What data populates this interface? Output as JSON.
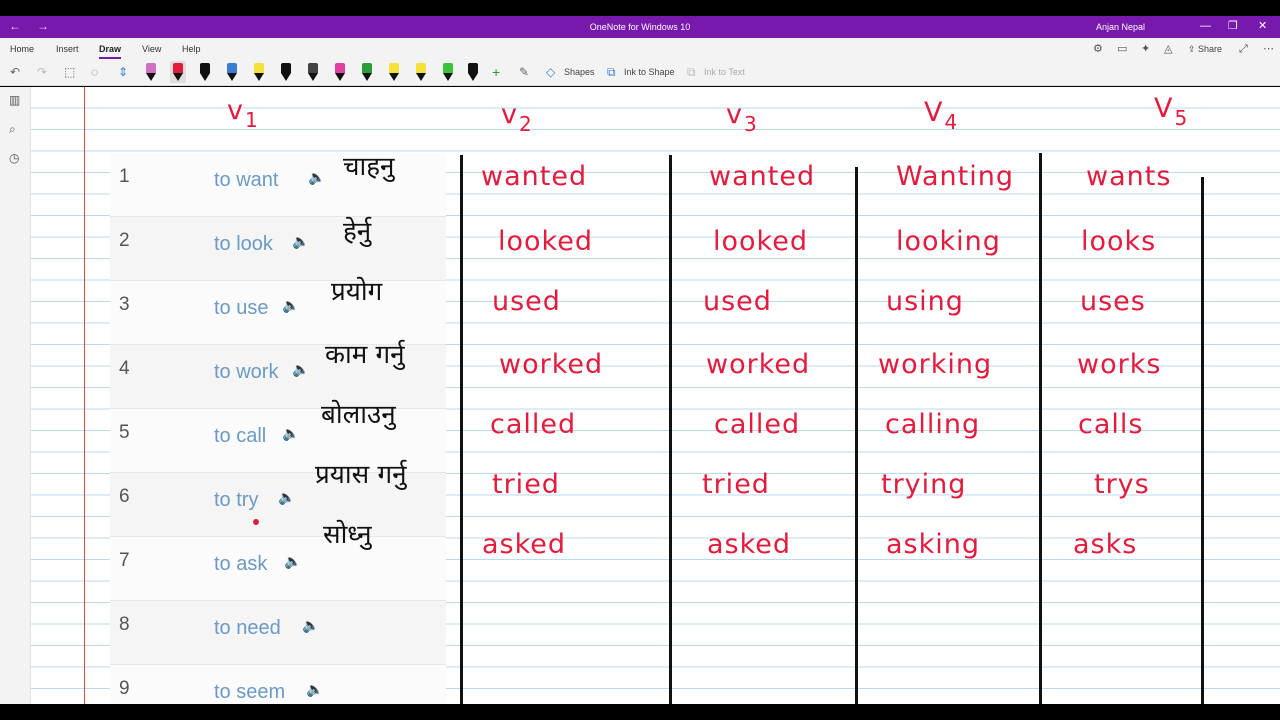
{
  "window": {
    "title": "OneNote for Windows 10",
    "user": "Anjan Nepal",
    "back_glyph": "←",
    "forward_glyph": "→",
    "minimize_glyph": "—",
    "restore_glyph": "❐",
    "close_glyph": "✕"
  },
  "ribbon": {
    "tabs": [
      "Home",
      "Insert",
      "Draw",
      "View",
      "Help"
    ],
    "active_tab": "Draw",
    "share_label": "Share"
  },
  "toolbar": {
    "undo_glyph": "↶",
    "redo_glyph": "↷",
    "add_pen_glyph": "+",
    "shapes_label": "Shapes",
    "ink_to_shape_label": "Ink to Shape",
    "ink_to_text_label": "Ink to Text",
    "pens": [
      {
        "color": "#d070c0"
      },
      {
        "color": "#e31c3d"
      },
      {
        "color": "#111111"
      },
      {
        "color": "#3a7bd5"
      },
      {
        "color": "#f4e23a"
      },
      {
        "color": "#111111"
      },
      {
        "color": "#444444"
      },
      {
        "color": "#e040a0"
      },
      {
        "color": "#2a9d3a"
      },
      {
        "color": "#f4e23a"
      },
      {
        "color": "#f4e23a"
      },
      {
        "color": "#3ac43a"
      },
      {
        "color": "#111111"
      }
    ]
  },
  "colors": {
    "title_bar": "#7719aa",
    "ink_red": "#e31c3d",
    "ink_black": "#111111",
    "word_blue": "#6b9ac4"
  },
  "vocab": [
    {
      "num": "1",
      "word": "to want"
    },
    {
      "num": "2",
      "word": "to look"
    },
    {
      "num": "3",
      "word": "to use"
    },
    {
      "num": "4",
      "word": "to work"
    },
    {
      "num": "5",
      "word": "to call"
    },
    {
      "num": "6",
      "word": "to try"
    },
    {
      "num": "7",
      "word": "to ask"
    },
    {
      "num": "8",
      "word": "to need"
    },
    {
      "num": "9",
      "word": "to seem"
    }
  ],
  "handwriting": {
    "headers": {
      "v1": {
        "letter": "v",
        "sub": "1"
      },
      "v2": {
        "letter": "v",
        "sub": "2"
      },
      "v3": {
        "letter": "v",
        "sub": "3"
      },
      "v4": {
        "letter": "V",
        "sub": "4"
      },
      "v5": {
        "letter": "V",
        "sub": "5"
      }
    },
    "nepali": [
      "चाहनु",
      "हेर्नु",
      "प्रयोग",
      "काम गर्नु",
      "बोलाउनु",
      "प्रयास गर्नु",
      "सोध्नु"
    ],
    "v2": [
      "wanted",
      "looked",
      "used",
      "worked",
      "called",
      "tried",
      "asked"
    ],
    "v3": [
      "wanted",
      "looked",
      "used",
      "worked",
      "called",
      "tried",
      "asked"
    ],
    "v4": [
      "Wanting",
      "looking",
      "using",
      "working",
      "calling",
      "trying",
      "asking"
    ],
    "v5": [
      "wants",
      "looks",
      "uses",
      "works",
      "calls",
      "trys",
      "asks"
    ]
  }
}
